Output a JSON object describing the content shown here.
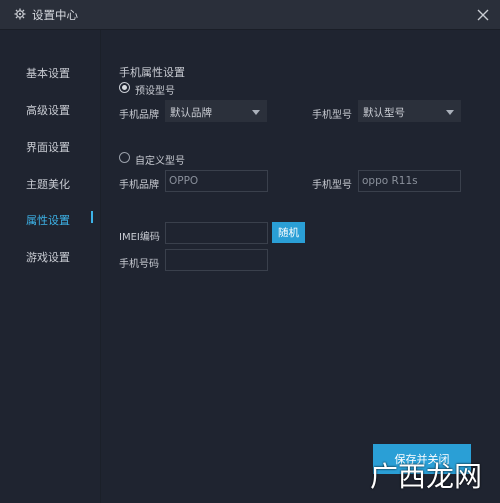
{
  "window": {
    "title": "设置中心",
    "icons": {
      "title": "gear-icon",
      "close": "close-icon"
    }
  },
  "sidebar": {
    "items": [
      {
        "label": "基本设置",
        "active": false
      },
      {
        "label": "高级设置",
        "active": false
      },
      {
        "label": "界面设置",
        "active": false
      },
      {
        "label": "主题美化",
        "active": false
      },
      {
        "label": "属性设置",
        "active": true
      },
      {
        "label": "游戏设置",
        "active": false
      }
    ]
  },
  "phone_props": {
    "section_title": "手机属性设置",
    "preset": {
      "radio_label": "预设型号",
      "checked": true,
      "brand_label": "手机品牌",
      "brand_value": "默认品牌",
      "model_label": "手机型号",
      "model_value": "默认型号"
    },
    "custom": {
      "radio_label": "自定义型号",
      "checked": false,
      "brand_label": "手机品牌",
      "brand_value": "OPPO",
      "model_label": "手机型号",
      "model_value": "oppo R11s"
    },
    "imei_label": "IMEI编码",
    "imei_value": "",
    "random_button": "随机",
    "phone_number_label": "手机号码",
    "phone_number_value": ""
  },
  "footer": {
    "save_button": "保存并关闭"
  },
  "watermark": "广西龙网",
  "colors": {
    "background": "#1f2430",
    "titlebar": "#2a2f3a",
    "accent": "#2a9fd6",
    "active_text": "#3db3e8",
    "text": "#c9ccd3"
  }
}
